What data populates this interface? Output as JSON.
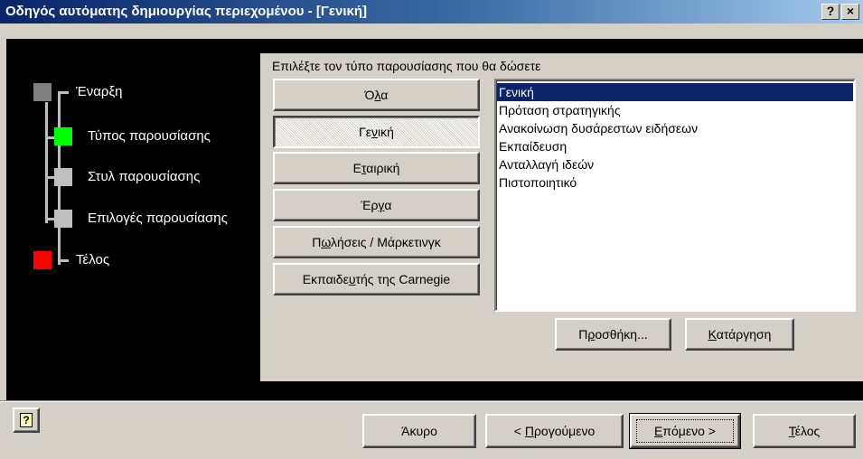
{
  "window": {
    "title": "Οδηγός αυτόματης δημιουργίας περιεχομένου - [Γενική]",
    "help_label": "?",
    "close_label": "×"
  },
  "steps": [
    {
      "label": "Έναρξη",
      "color": "#808080"
    },
    {
      "label": "Τύπος παρουσίασης",
      "color": "#00ff00"
    },
    {
      "label": "Στυλ παρουσίασης",
      "color": "#c0c0c0"
    },
    {
      "label": "Επιλογές παρουσίασης",
      "color": "#c0c0c0"
    },
    {
      "label": "Τέλος",
      "color": "#ff0000"
    }
  ],
  "prompt": "Επιλέξτε τον τύπο παρουσίασης που θα δώσετε",
  "categories": [
    {
      "pre": "Ό",
      "u": "λ",
      "post": "α",
      "pressed": false
    },
    {
      "pre": "Γε",
      "u": "ν",
      "post": "ική",
      "pressed": true
    },
    {
      "pre": "Ε",
      "u": "τ",
      "post": "αιρική",
      "pressed": false
    },
    {
      "pre": "Έρ",
      "u": "γ",
      "post": "α",
      "pressed": false
    },
    {
      "pre": "Π",
      "u": "ω",
      "post": "λήσεις / Μάρκετινγκ",
      "pressed": false
    },
    {
      "pre": "Εκπαιδε",
      "u": "υ",
      "post": "τής της Carnegie",
      "pressed": false
    }
  ],
  "list_items": [
    "Γενική",
    "Πρόταση στρατηγικής",
    "Ανακοίνωση δυσάρεστων ειδήσεων",
    "Εκπαίδευση",
    "Ανταλλαγή ιδεών",
    "Πιστοποιητικό"
  ],
  "selected_list_index": 0,
  "list_buttons": {
    "add": {
      "pre": "Π",
      "u": "ρ",
      "post": "οσθήκη..."
    },
    "remove": {
      "pre": "",
      "u": "Κ",
      "post": "ατάργηση"
    }
  },
  "footer": {
    "help_icon": "help-icon",
    "cancel": {
      "pre": "Άκυρο",
      "u": "",
      "post": ""
    },
    "back": {
      "pre": "< ",
      "u": "Π",
      "post": "ρογούμενο"
    },
    "next": {
      "pre": "",
      "u": "Ε",
      "post": "πόμενο >"
    },
    "finish": {
      "pre": "",
      "u": "Τ",
      "post": "έλος"
    }
  },
  "colors": {
    "title_gradient_start": "#0a246a",
    "title_gradient_end": "#a6caf0",
    "selection": "#0a246a",
    "face": "#d4d0c8"
  }
}
